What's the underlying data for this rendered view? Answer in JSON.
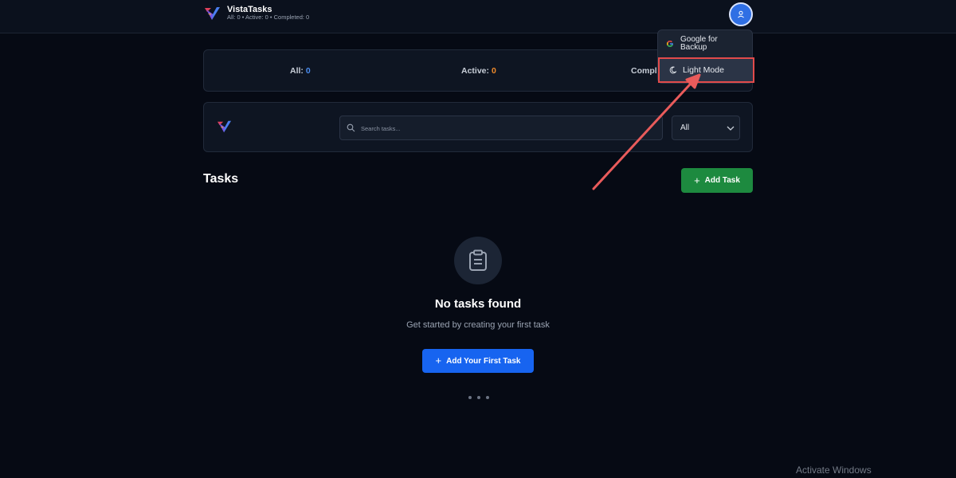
{
  "app": {
    "title": "VistaTasks",
    "stats_line": "All: 0 • Active: 0 • Completed: 0"
  },
  "menu": {
    "google_label": "Google for Backup",
    "light_mode_label": "Light Mode"
  },
  "stats": {
    "all_label": "All:",
    "all_value": "0",
    "active_label": "Active:",
    "active_value": "0",
    "completed_label": "Compl"
  },
  "search": {
    "placeholder": "Search tasks..."
  },
  "filter": {
    "selected": "All"
  },
  "tasks": {
    "heading": "Tasks",
    "add_button": "Add Task"
  },
  "empty_state": {
    "title": "No tasks found",
    "subtitle": "Get started by creating your first task",
    "button": "Add Your First Task"
  },
  "watermark": "Activate Windows",
  "colors": {
    "accent_blue": "#1764f0",
    "accent_green": "#1d8a3f",
    "active_orange": "#f08a2b",
    "all_blue": "#4b8df0",
    "highlight_red": "#e24b4b"
  }
}
